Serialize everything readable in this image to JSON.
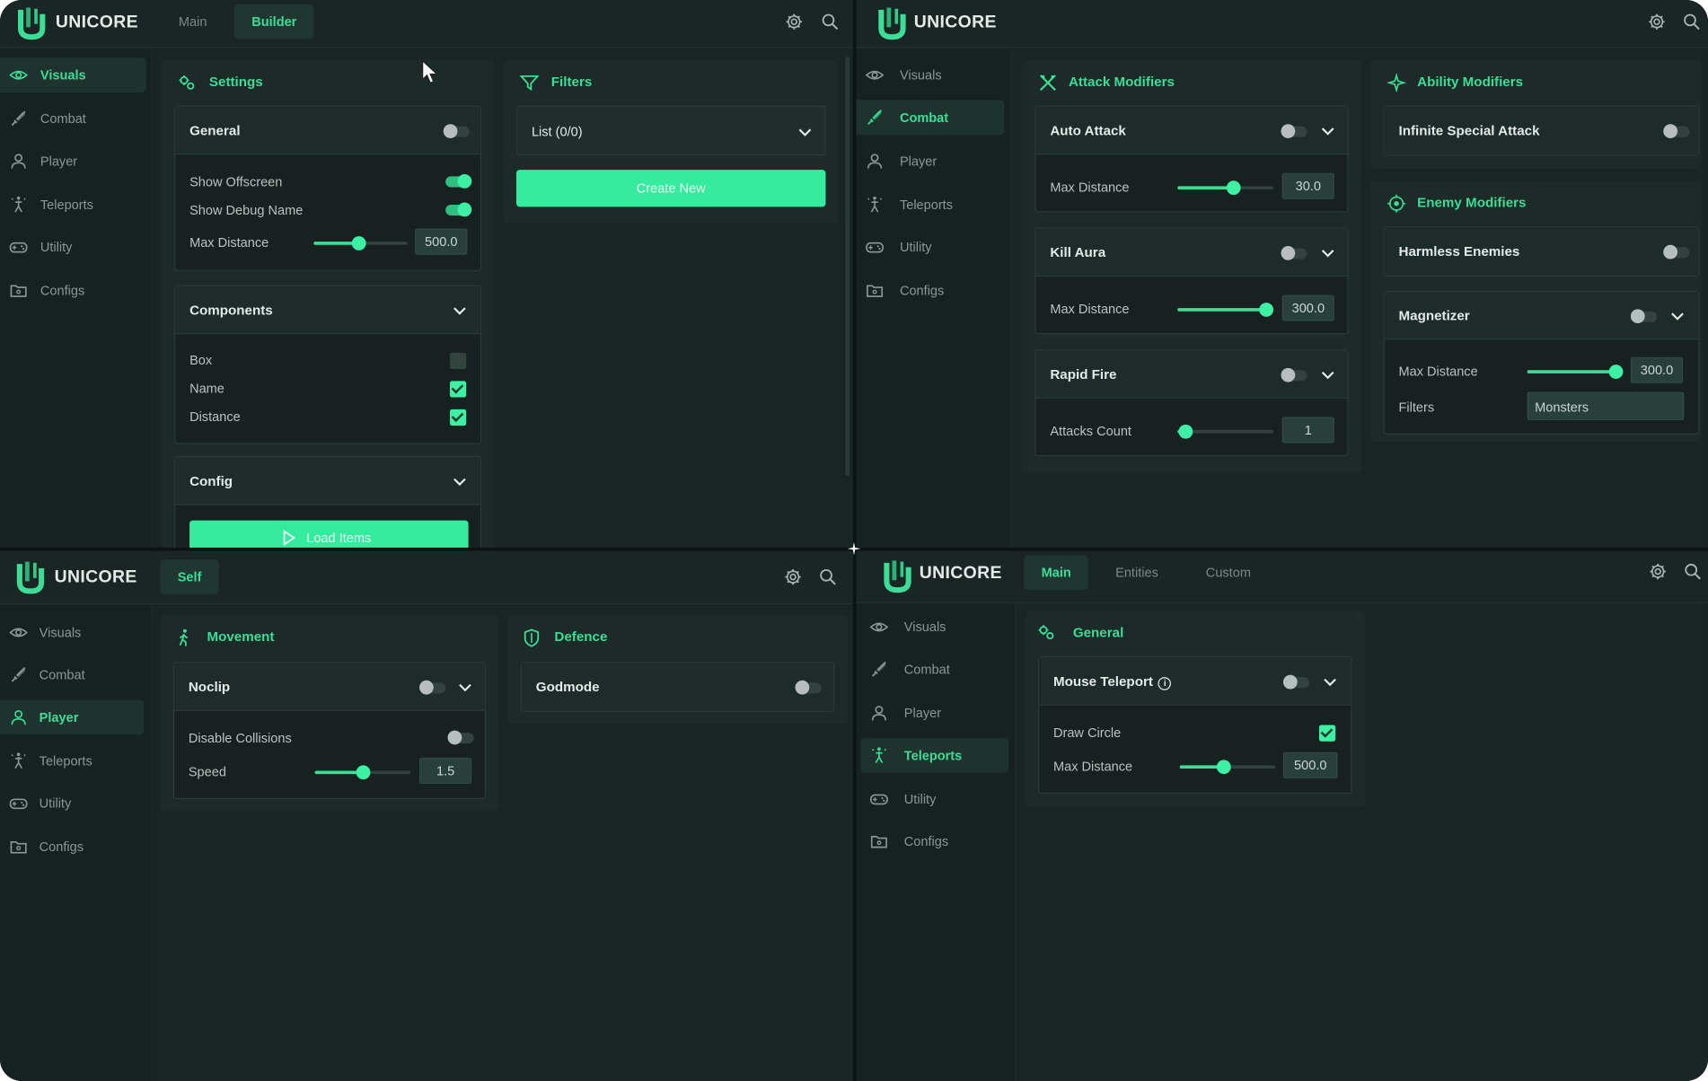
{
  "app": {
    "name": "UNICORE"
  },
  "colors": {
    "accent": "#3ddc97",
    "background": "#182523",
    "panel": "#1c2a28"
  },
  "icons": {
    "settings": "gear-icon",
    "search": "search-icon",
    "expand": "chevron-down-icon"
  },
  "nav": [
    "Visuals",
    "Combat",
    "Player",
    "Teleports",
    "Utility",
    "Configs"
  ],
  "q1": {
    "tabs": [
      "Main",
      "Builder"
    ],
    "active_tab": "Builder",
    "active_nav": "Visuals",
    "settings": {
      "title": "Settings",
      "general": {
        "title": "General",
        "enabled": false,
        "show_offscreen": {
          "label": "Show Offscreen",
          "on": true
        },
        "show_debug": {
          "label": "Show Debug Name",
          "on": true
        },
        "max_distance": {
          "label": "Max Distance",
          "value": "500.0",
          "level": 0.48
        }
      },
      "components": {
        "title": "Components",
        "items": [
          {
            "label": "Box",
            "checked": false
          },
          {
            "label": "Name",
            "checked": true
          },
          {
            "label": "Distance",
            "checked": true
          }
        ]
      },
      "config": {
        "title": "Config",
        "button": "Load Items"
      }
    },
    "filters": {
      "title": "Filters",
      "select": "List (0/0)",
      "button": "Create New"
    }
  },
  "q2": {
    "active_nav": "Combat",
    "attack": {
      "title": "Attack Modifiers",
      "auto_attack": {
        "title": "Auto Attack",
        "on": false,
        "label": "Max Distance",
        "value": "30.0",
        "level": 0.58
      },
      "kill_aura": {
        "title": "Kill Aura",
        "on": false,
        "label": "Max Distance",
        "value": "300.0",
        "level": 0.92
      },
      "rapid_fire": {
        "title": "Rapid Fire",
        "on": false,
        "label": "Attacks Count",
        "value": "1",
        "level": 0.08
      }
    },
    "ability": {
      "title": "Ability Modifiers",
      "infinite": {
        "title": "Infinite Special Attack",
        "on": false
      }
    },
    "enemy": {
      "title": "Enemy Modifiers",
      "harmless": {
        "title": "Harmless Enemies",
        "on": false
      },
      "magnetizer": {
        "title": "Magnetizer",
        "on": false,
        "label": "Max Distance",
        "value": "300.0",
        "level": 0.92,
        "filters_label": "Filters",
        "filters_value": "Monsters"
      }
    }
  },
  "q3": {
    "tabs": [
      "Self"
    ],
    "active_nav": "Player",
    "movement": {
      "title": "Movement",
      "noclip": {
        "title": "Noclip",
        "on": false
      },
      "collisions": {
        "label": "Disable Collisions",
        "on": false
      },
      "speed": {
        "label": "Speed",
        "value": "1.5",
        "level": 0.5
      }
    },
    "defence": {
      "title": "Defence",
      "godmode": {
        "title": "Godmode",
        "on": false
      }
    }
  },
  "q4": {
    "tabs": [
      "Main",
      "Entities",
      "Custom"
    ],
    "active_tab": "Main",
    "active_nav": "Teleports",
    "general": {
      "title": "General",
      "mouse_teleport": {
        "title": "Mouse Teleport",
        "on": false,
        "info": "i"
      },
      "draw_circle": {
        "label": "Draw Circle",
        "checked": true
      },
      "max_distance": {
        "label": "Max Distance",
        "value": "500.0",
        "level": 0.46
      }
    }
  }
}
